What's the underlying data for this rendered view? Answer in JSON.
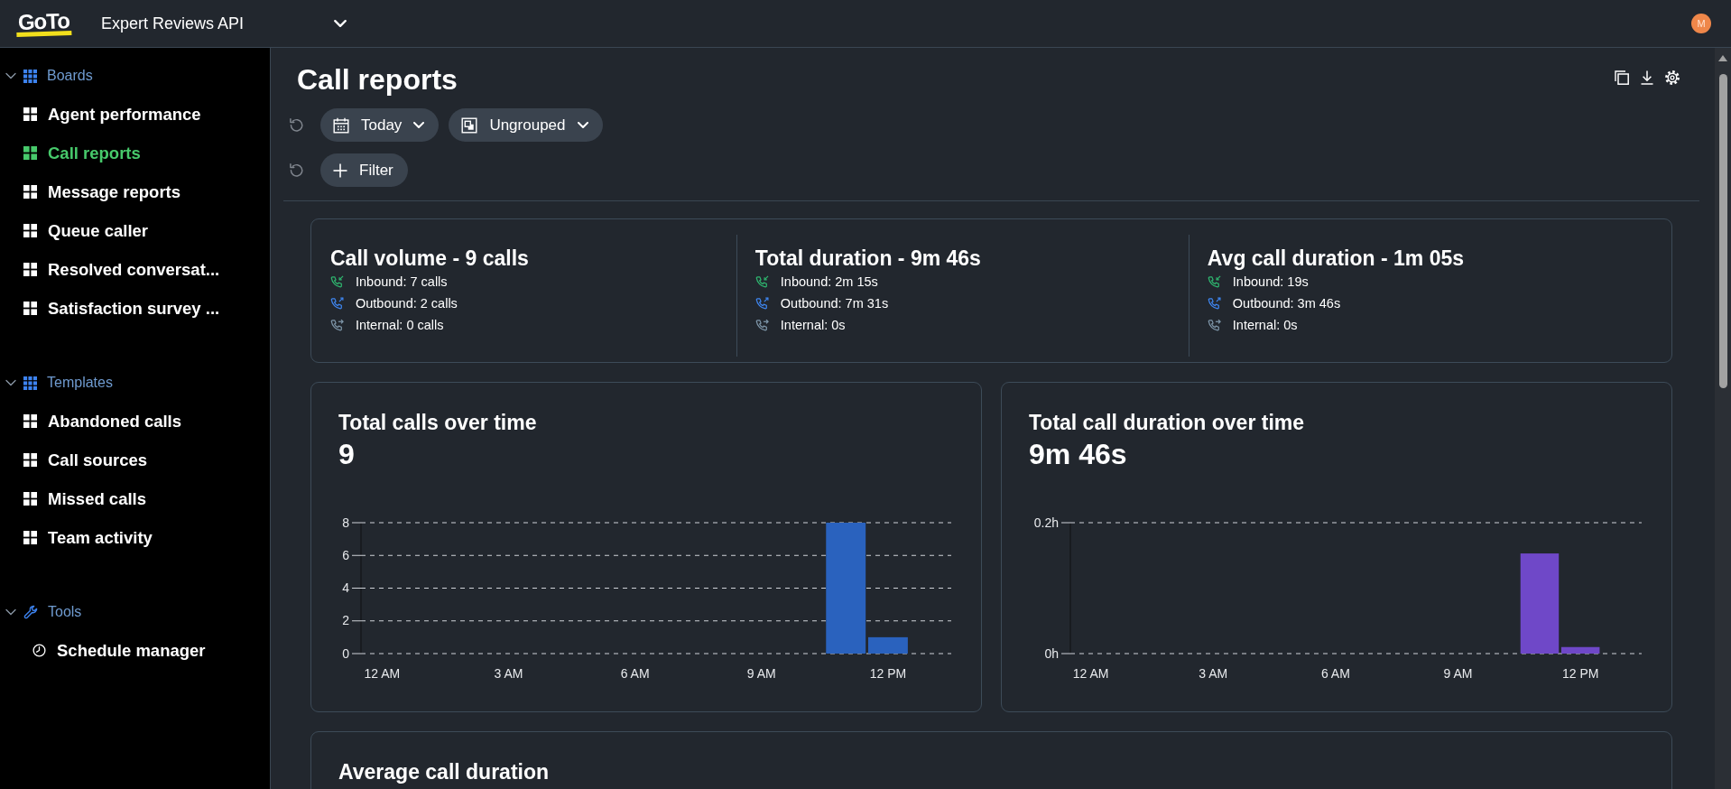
{
  "top_bar": {
    "logo": "GoTo",
    "workspace": "Expert Reviews API",
    "avatar": "M"
  },
  "sidebar": {
    "sections": [
      {
        "title": "Boards",
        "kind": "grid",
        "expanded": true,
        "items": [
          {
            "label": "Agent performance",
            "kind": "board",
            "selected": false
          },
          {
            "label": "Call reports",
            "kind": "board",
            "selected": true
          },
          {
            "label": "Message reports",
            "kind": "board",
            "selected": false
          },
          {
            "label": "Queue caller",
            "kind": "board",
            "selected": false
          },
          {
            "label": "Resolved conversat...",
            "kind": "board",
            "selected": false
          },
          {
            "label": "Satisfaction survey ...",
            "kind": "board",
            "selected": false
          }
        ]
      },
      {
        "title": "Templates",
        "kind": "grid",
        "expanded": true,
        "items": [
          {
            "label": "Abandoned calls",
            "kind": "board",
            "selected": false
          },
          {
            "label": "Call sources",
            "kind": "board",
            "selected": false
          },
          {
            "label": "Missed calls",
            "kind": "board",
            "selected": false
          },
          {
            "label": "Team activity",
            "kind": "board",
            "selected": false
          }
        ]
      },
      {
        "title": "Tools",
        "kind": "wrench",
        "expanded": true,
        "items": [
          {
            "label": "Schedule manager",
            "kind": "schedule",
            "selected": false
          }
        ]
      }
    ]
  },
  "page": {
    "title": "Call reports"
  },
  "filters": [
    {
      "controls": [
        {
          "kind": "date",
          "label": "Today"
        },
        {
          "kind": "grouping",
          "label": "Ungrouped"
        }
      ]
    },
    {
      "controls": [
        {
          "kind": "add",
          "label": "Filter"
        }
      ]
    }
  ],
  "summary": [
    {
      "title": "Call volume - 9 calls",
      "lines": [
        {
          "kind": "inbound",
          "text": "Inbound: 7 calls"
        },
        {
          "kind": "outbound",
          "text": "Outbound: 2 calls"
        },
        {
          "kind": "internal",
          "text": "Internal: 0 calls"
        }
      ]
    },
    {
      "title": "Total duration - 9m 46s",
      "lines": [
        {
          "kind": "inbound",
          "text": "Inbound: 2m 15s"
        },
        {
          "kind": "outbound",
          "text": "Outbound: 7m 31s"
        },
        {
          "kind": "internal",
          "text": "Internal: 0s"
        }
      ]
    },
    {
      "title": "Avg call duration - 1m 05s",
      "lines": [
        {
          "kind": "inbound",
          "text": "Inbound: 19s"
        },
        {
          "kind": "outbound",
          "text": "Outbound: 3m 46s"
        },
        {
          "kind": "internal",
          "text": "Internal: 0s"
        }
      ]
    }
  ],
  "charts": [
    {
      "title": "Total calls over time",
      "value": "9",
      "chart_data": {
        "type": "bar",
        "categories": [
          "12 AM",
          null,
          null,
          "3 AM",
          null,
          null,
          "6 AM",
          null,
          null,
          "9 AM",
          null,
          null,
          "12 PM",
          null
        ],
        "series": [
          {
            "color": "#2a62be",
            "values": [
              0,
              0,
              0,
              0,
              0,
              0,
              0,
              0,
              0,
              0,
              0,
              8,
              1,
              0
            ]
          }
        ],
        "ylim": [
          0,
          8
        ],
        "yticks": [
          0,
          2,
          4,
          6,
          8
        ],
        "grid": true
      }
    },
    {
      "title": "Total call duration over time",
      "value": "9m 46s",
      "chart_data": {
        "type": "bar",
        "categories": [
          "12 AM",
          null,
          null,
          "3 AM",
          null,
          null,
          "6 AM",
          null,
          null,
          "9 AM",
          null,
          null,
          "12 PM",
          null
        ],
        "series": [
          {
            "color": "#6f48c8",
            "values": [
              0,
              0,
              0,
              0,
              0,
              0,
              0,
              0,
              0,
              0,
              0,
              0.153,
              0.01,
              0
            ]
          }
        ],
        "ylim": [
          0,
          0.2
        ],
        "yticks": [
          {
            "value": 0,
            "label": "0h"
          },
          {
            "value": 0.2,
            "label": "0.2h"
          }
        ],
        "grid": true
      }
    }
  ],
  "next_card": {
    "title": "Average call duration"
  }
}
